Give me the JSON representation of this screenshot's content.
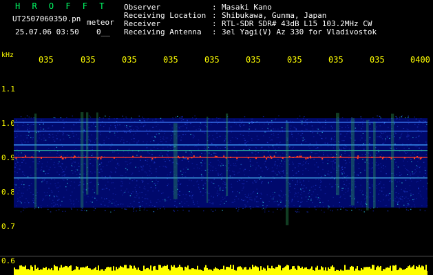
{
  "header": {
    "title": "H R O F F T",
    "filename": "UT2507060350.pn",
    "filename_suffix": "meteor",
    "date_time": "25.07.06 03:50",
    "flag": "0__"
  },
  "info": [
    {
      "label": "Observer",
      "sep": ":",
      "value": "Masaki Kano"
    },
    {
      "label": "Receiving Location",
      "sep": ":",
      "value": "Shibukawa, Gunma, Japan"
    },
    {
      "label": "Receiver",
      "sep": ":",
      "value": "RTL-SDR SDR# 43dB L15 103.2MHz CW"
    },
    {
      "label": "Receiving Antenna",
      "sep": ":",
      "value": "3el Yagi(V) Az 330 for Vladivostok"
    }
  ],
  "axes": {
    "frequency_unit": "kHz",
    "time_labels": [
      "035",
      "035",
      "035",
      "035",
      "035",
      "035",
      "035",
      "035",
      "035",
      "0400"
    ],
    "frequency_labels": [
      "1.1",
      "1.0",
      "0.9",
      "0.8",
      "0.7",
      "0.6"
    ]
  },
  "colors": {
    "background": "#000000",
    "axis_label": "#ffff00",
    "title": "#00ff66",
    "spectrogram_base": "#000a78",
    "signal_band": "#2040d0",
    "carrier_line": "#ff3c28",
    "noise_floor": "#ffff00"
  }
}
